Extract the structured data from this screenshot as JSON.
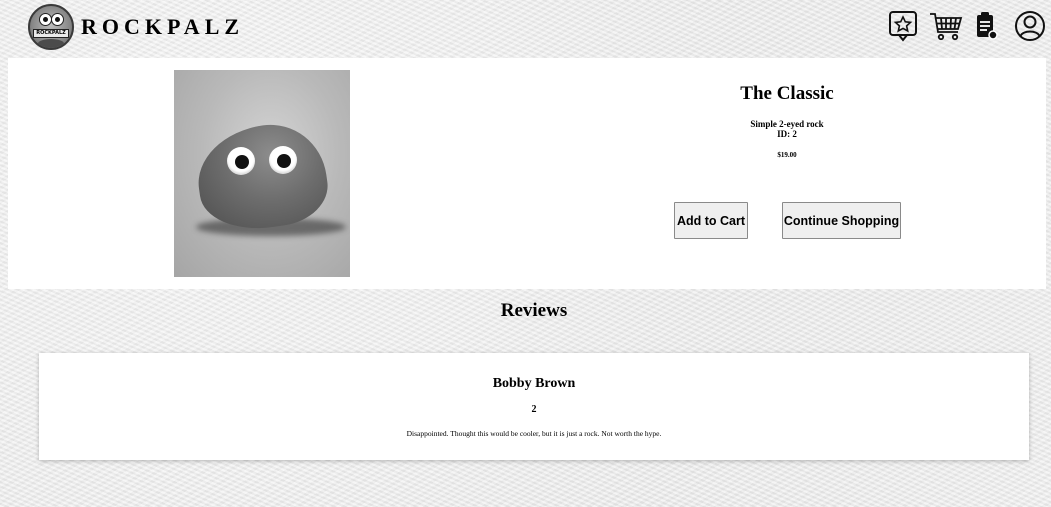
{
  "header": {
    "brand": "ROCKPALZ",
    "logo_text": "ROCKPALZ",
    "icons": [
      "favorites-icon",
      "cart-icon",
      "orders-icon",
      "account-icon"
    ]
  },
  "product": {
    "title": "The Classic",
    "description": "Simple 2-eyed rock",
    "id_label": "ID: 2",
    "price": "$19.00",
    "add_to_cart_label": "Add to Cart",
    "continue_label": "Continue Shopping"
  },
  "reviews": {
    "title": "Reviews",
    "items": [
      {
        "name": "Bobby Brown",
        "rating": "2",
        "text": "Disappointed. Thought this would be cooler, but it is just a rock. Not worth the hype."
      }
    ]
  },
  "colors": {
    "panel": "#ffffff",
    "button_bg": "#efefef",
    "background": "#eeeeee"
  }
}
